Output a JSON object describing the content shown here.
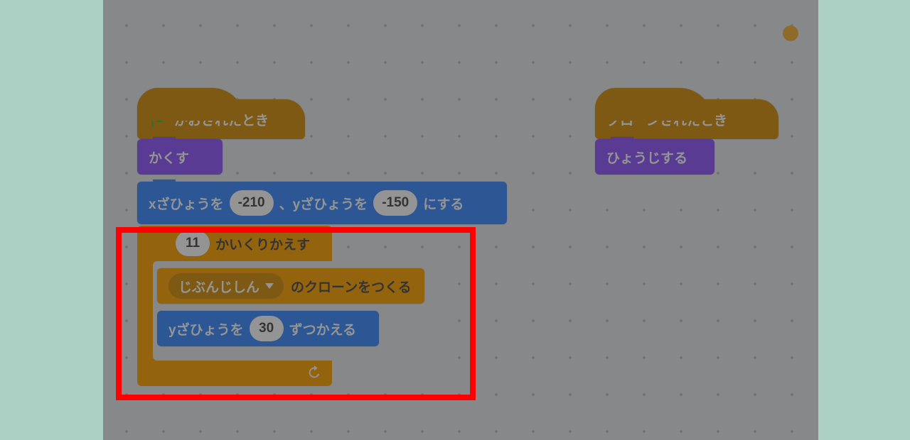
{
  "decoration": {
    "dot_name": "decorative-dot"
  },
  "script1": {
    "hat_label": "がおされたとき",
    "hide_label": "かくす",
    "goto_prefix": "xざひょうを",
    "goto_mid": "、yざひょうを",
    "goto_suffix": "にする",
    "goto_x": "-210",
    "goto_y": "-150",
    "repeat_count": "11",
    "repeat_label": "かいくりかえす",
    "clone_menu": "じぶんじしん",
    "clone_suffix": "のクローンをつくる",
    "change_y_prefix": "yざひょうを",
    "change_y_val": "30",
    "change_y_suffix": "ずつかえる"
  },
  "script2": {
    "hat_label": "クローンされたとき",
    "show_label": "ひょうじする"
  },
  "colors": {
    "events": "#d99a21",
    "looks": "#9966ff",
    "motion": "#4c97ff",
    "control": "#ffab19"
  }
}
